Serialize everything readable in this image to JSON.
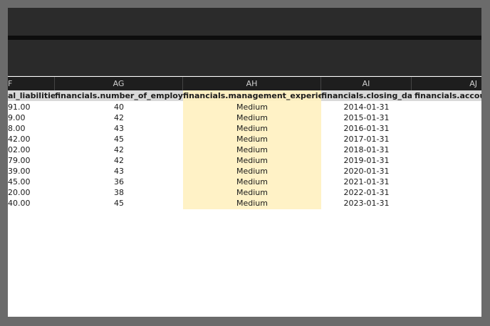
{
  "columns": [
    {
      "letter": "F"
    },
    {
      "letter": "AG"
    },
    {
      "letter": "AH"
    },
    {
      "letter": "AI"
    },
    {
      "letter": "AJ"
    }
  ],
  "header_row": [
    "al_liabilities",
    "financials.number_of_employees",
    "financials.management_experience",
    "financials.closing_date",
    "financials.account"
  ],
  "rows": [
    [
      "91.00",
      "40",
      "Medium",
      "2014-01-31",
      ""
    ],
    [
      "9.00",
      "42",
      "Medium",
      "2015-01-31",
      ""
    ],
    [
      "8.00",
      "43",
      "Medium",
      "2016-01-31",
      ""
    ],
    [
      "42.00",
      "45",
      "Medium",
      "2017-01-31",
      ""
    ],
    [
      "02.00",
      "42",
      "Medium",
      "2018-01-31",
      ""
    ],
    [
      "79.00",
      "42",
      "Medium",
      "2019-01-31",
      ""
    ],
    [
      "39.00",
      "43",
      "Medium",
      "2020-01-31",
      ""
    ],
    [
      "45.00",
      "36",
      "Medium",
      "2021-01-31",
      ""
    ],
    [
      "20.00",
      "38",
      "Medium",
      "2022-01-31",
      ""
    ],
    [
      "40.00",
      "45",
      "Medium",
      "2023-01-31",
      ""
    ]
  ],
  "selected_column": "AH",
  "colors": {
    "header_bg": "#d9d9d9",
    "selected_header_bg": "#fcefc2",
    "selected_column_bg": "#fff2c6"
  }
}
